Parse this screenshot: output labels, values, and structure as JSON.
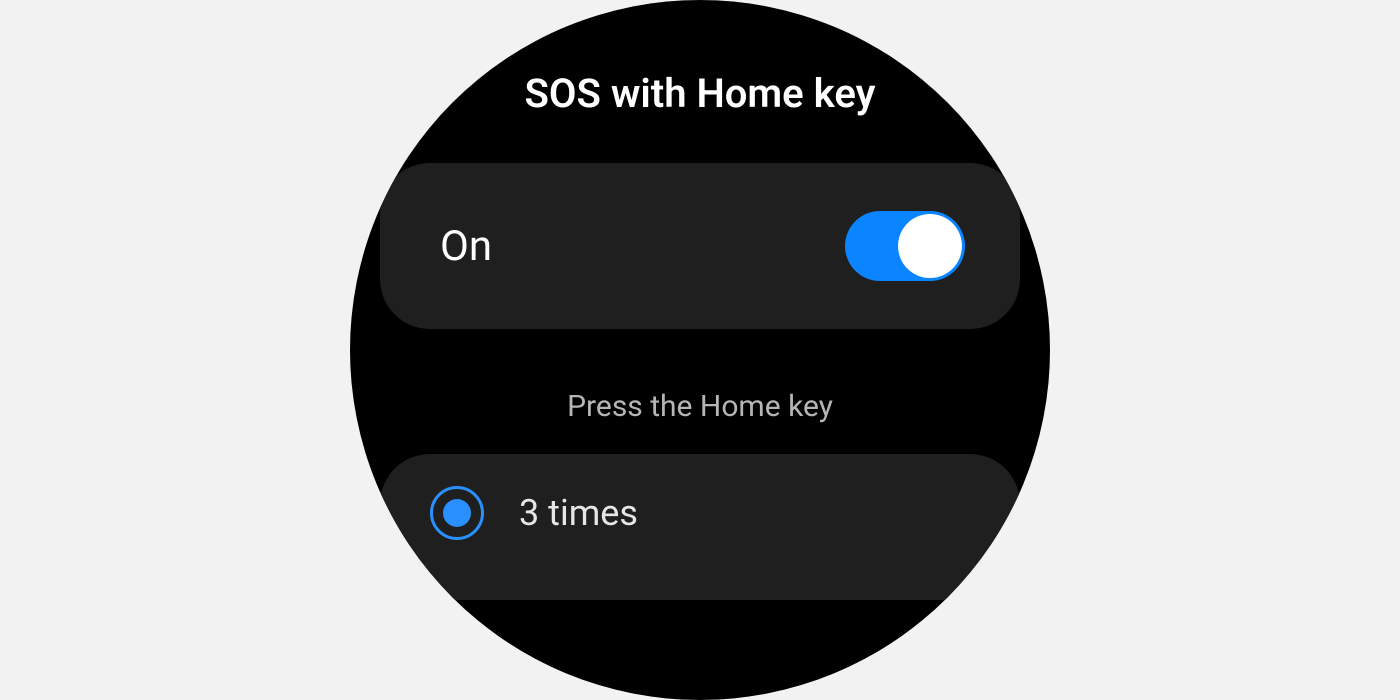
{
  "header": {
    "title": "SOS with Home key"
  },
  "toggle": {
    "label": "On",
    "state": "on",
    "accent_color": "#0a84ff"
  },
  "section": {
    "label": "Press the Home key"
  },
  "options": [
    {
      "label": "3 times",
      "selected": true
    }
  ]
}
